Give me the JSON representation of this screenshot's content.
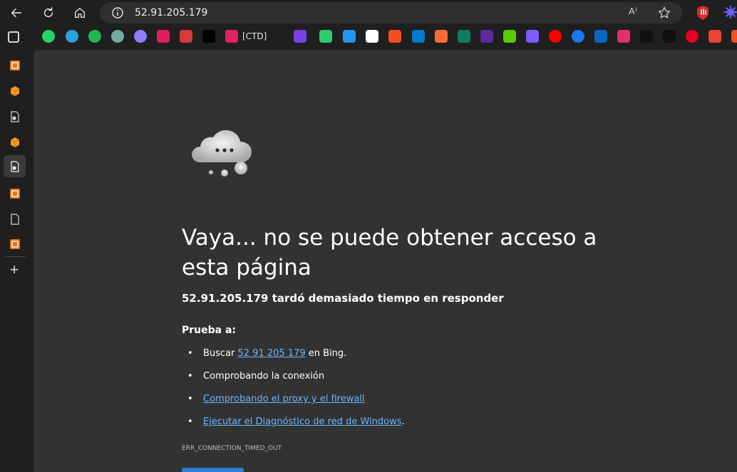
{
  "browser": {
    "url": "52.91.205.179",
    "readaloud_label": "A⁾"
  },
  "favorites": {
    "text_item": "[CTD]",
    "icons": [
      {
        "name": "whatsapp-icon",
        "color": "#25d366"
      },
      {
        "name": "telegram-icon",
        "color": "#2aa1de"
      },
      {
        "name": "spotify-icon",
        "color": "#1db954"
      },
      {
        "name": "chatgpt-icon",
        "color": "#74aa9c"
      },
      {
        "name": "gemini-icon",
        "color": "#8f7bff"
      },
      {
        "name": "slack-icon",
        "color": "#e01e5a"
      },
      {
        "name": "counter-icon",
        "color": "#d63b3b"
      },
      {
        "name": "dark-app-icon",
        "color": "#000000"
      },
      {
        "name": "heart-app-icon",
        "color": "#e0245e"
      },
      {
        "name": "purple-app-icon",
        "color": "#7b3fe4"
      },
      {
        "name": "green-app-icon",
        "color": "#2ecc71"
      },
      {
        "name": "blue-square-icon",
        "color": "#2196f3"
      },
      {
        "name": "github-icon",
        "color": "#ffffff"
      },
      {
        "name": "figma-icon",
        "color": "#f24e1e"
      },
      {
        "name": "vscode-icon",
        "color": "#007acc"
      },
      {
        "name": "orange-app-icon",
        "color": "#ff6b35"
      },
      {
        "name": "teal-app-icon",
        "color": "#0e7c66"
      },
      {
        "name": "r-app-icon",
        "color": "#5b2ca0"
      },
      {
        "name": "duolingo-icon",
        "color": "#58cc02"
      },
      {
        "name": "s-app-icon",
        "color": "#7b5cff"
      },
      {
        "name": "youtube-icon",
        "color": "#ff0000"
      },
      {
        "name": "facebook-icon",
        "color": "#1877f2"
      },
      {
        "name": "linkedin-icon",
        "color": "#0a66c2"
      },
      {
        "name": "instagram-icon",
        "color": "#e1306c"
      },
      {
        "name": "tiktok-icon",
        "color": "#111111"
      },
      {
        "name": "x-icon",
        "color": "#111111"
      },
      {
        "name": "pinterest-icon",
        "color": "#e60023"
      },
      {
        "name": "gmail-icon",
        "color": "#ea4335"
      },
      {
        "name": "microsoft-icon",
        "color": "#f25022"
      },
      {
        "name": "folder-icon",
        "color": "#f4b400"
      }
    ]
  },
  "error": {
    "title": "Vaya... no se puede obtener acceso a esta página",
    "host": "52.91.205.179",
    "subtitle_rest": " tardó demasiado tiempo en responder",
    "try_label": "Prueba a:",
    "search_prefix": "Buscar ",
    "search_link": "52 91 205 179",
    "search_suffix": " en Bing.",
    "check_connection": "Comprobando la conexión",
    "proxy_link": "Comprobando el proxy y el firewall",
    "diagnostics_link": "Ejecutar el Diagnóstico de red de Windows",
    "diagnostics_suffix": ".",
    "code": "ERR_CONNECTION_TIMED_OUT"
  },
  "colors": {
    "link": "#6cb4ff",
    "button": "#2b7fd4",
    "page_bg": "#323232"
  }
}
